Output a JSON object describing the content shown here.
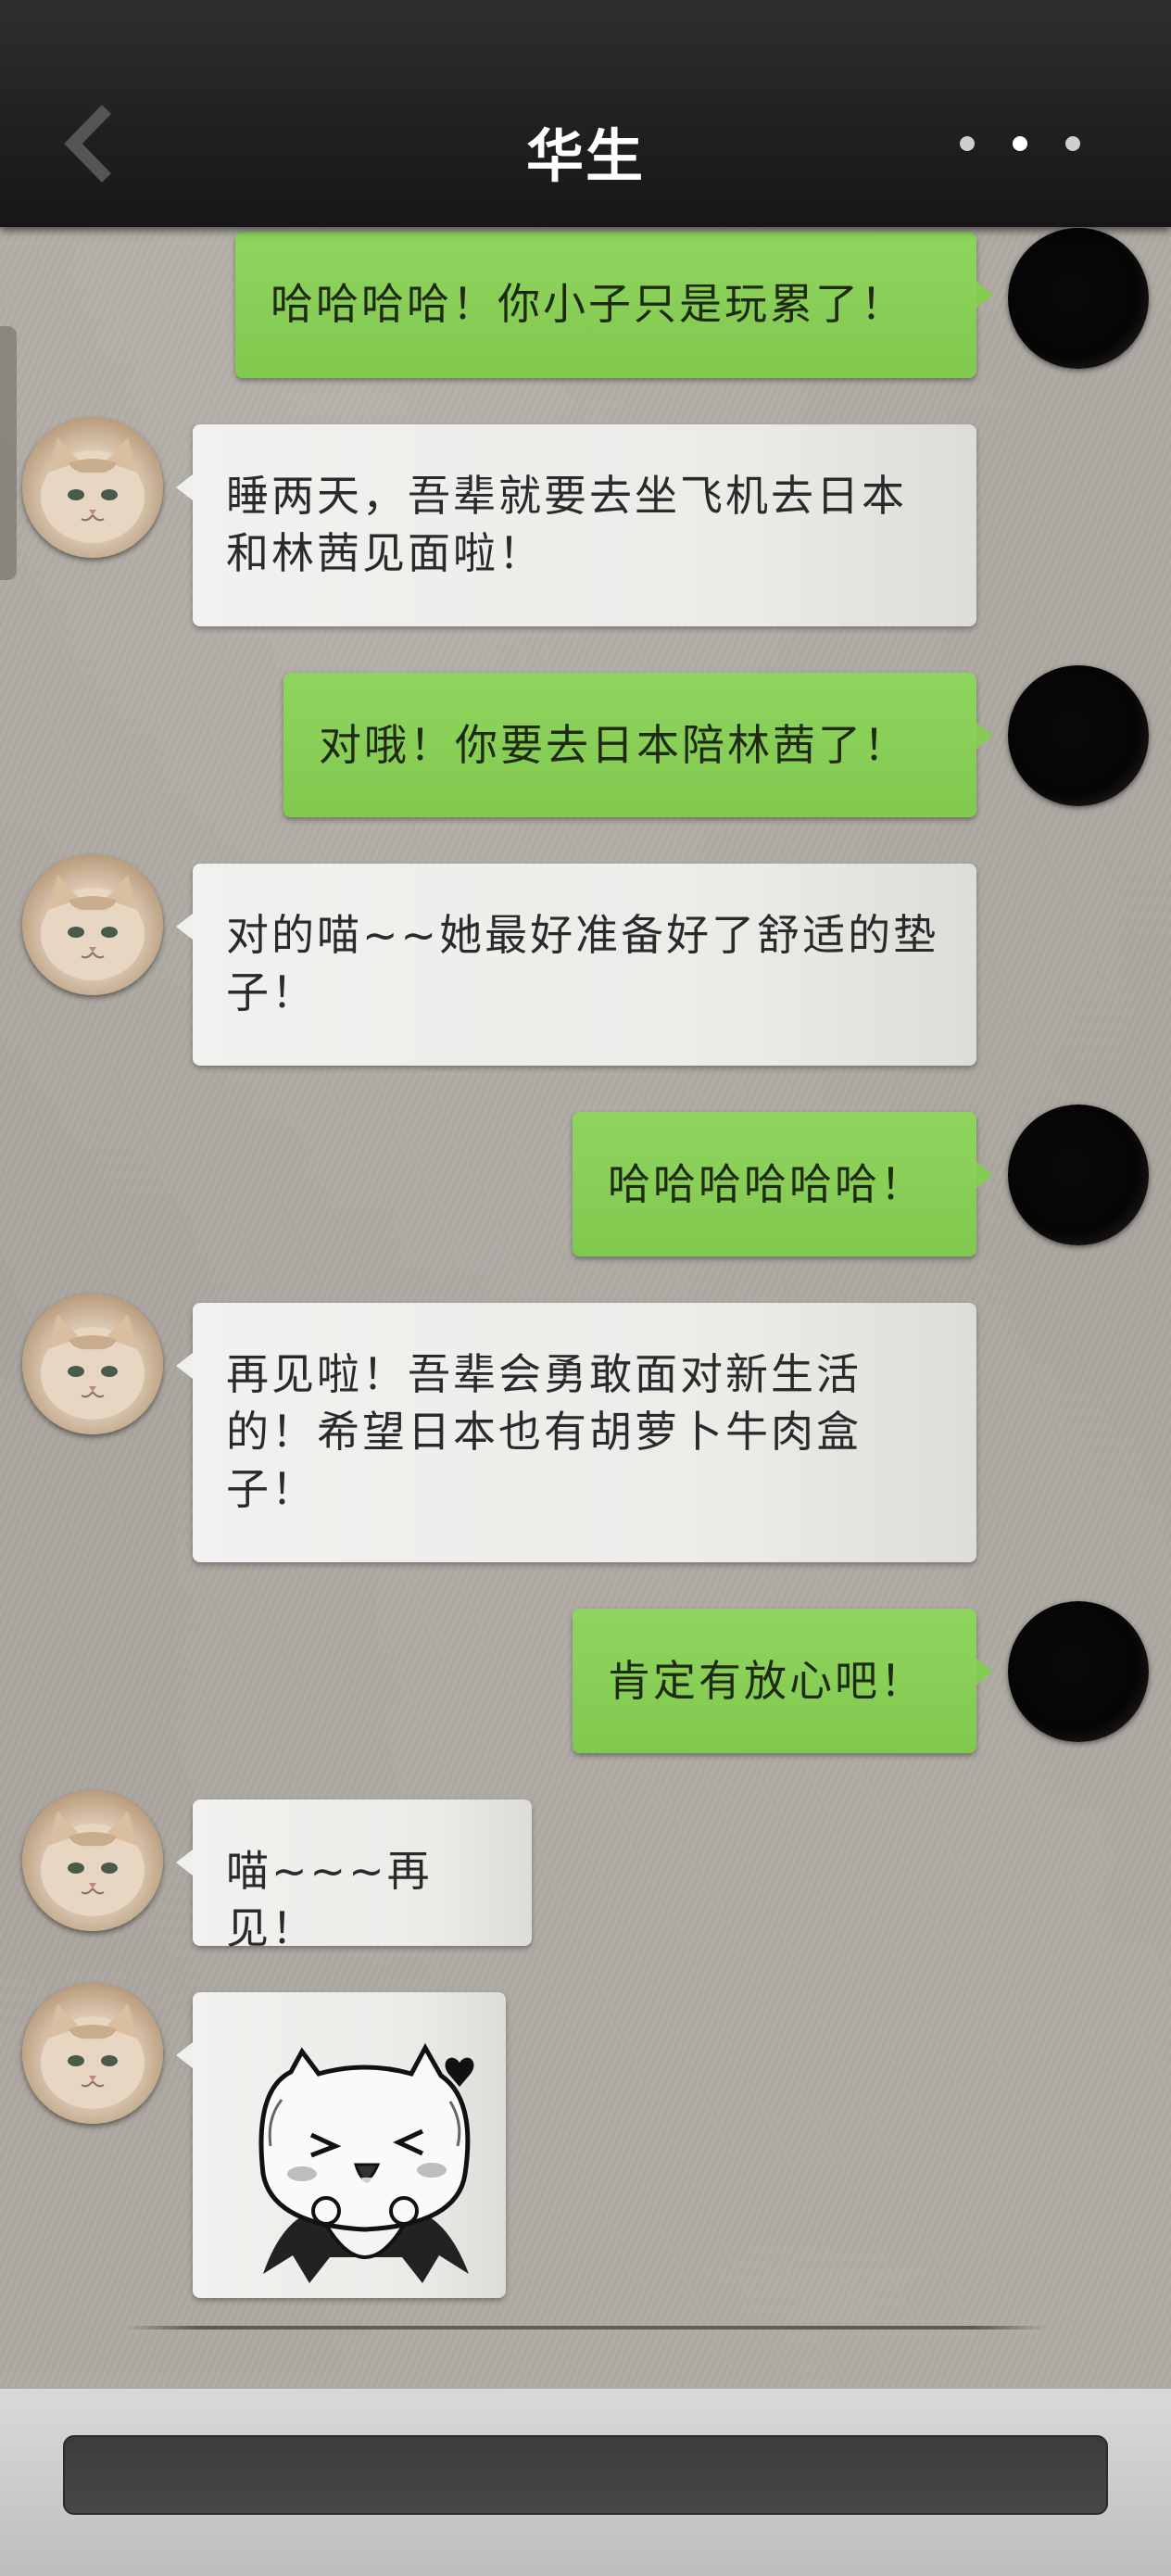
{
  "header": {
    "title": "华生",
    "back_icon": "chevron-left-icon",
    "more_icon": "more-dots-icon"
  },
  "messages": [
    {
      "side": "right",
      "type": "text",
      "text_lines": [
        "哈哈哈哈！你小子只是玩累了！"
      ]
    },
    {
      "side": "left",
      "type": "text",
      "text_lines": [
        "睡两天，吾辈就要去坐飞机去日本",
        "和林茜见面啦！"
      ]
    },
    {
      "side": "right",
      "type": "text",
      "text_lines": [
        "对哦！你要去日本陪林茜了！"
      ]
    },
    {
      "side": "left",
      "type": "text",
      "text_lines": [
        "对的喵~~她最好准备好了舒适的垫",
        "子！"
      ]
    },
    {
      "side": "right",
      "type": "text",
      "text_lines": [
        "哈哈哈哈哈哈！"
      ]
    },
    {
      "side": "left",
      "type": "text",
      "text_lines": [
        "再见啦！吾辈会勇敢面对新生活",
        "的！希望日本也有胡萝卜牛肉盒",
        "子！"
      ]
    },
    {
      "side": "right",
      "type": "text",
      "text_lines": [
        "肯定有放心吧！"
      ]
    },
    {
      "side": "left",
      "type": "text",
      "text_lines": [
        "喵~~~再见！"
      ]
    },
    {
      "side": "left",
      "type": "sticker",
      "sticker": "cat-vampire-sticker"
    }
  ],
  "input": {
    "value": "",
    "placeholder": ""
  },
  "colors": {
    "header_bg": "#1d1d1d",
    "outgoing_bubble": "#86cc52",
    "incoming_bubble": "#efefed",
    "chat_bg": "#aaa59e",
    "input_field": "#424242"
  }
}
